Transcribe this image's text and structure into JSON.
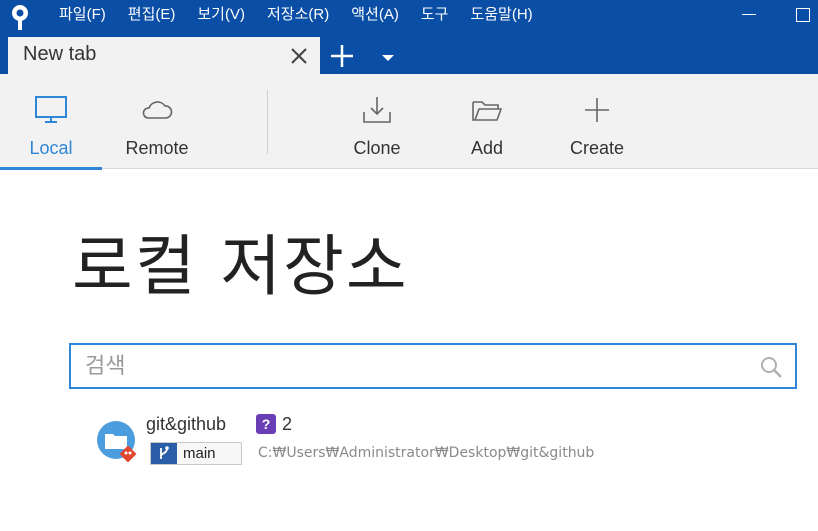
{
  "menu": {
    "items": [
      "파일(F)",
      "편집(E)",
      "보기(V)",
      "저장소(R)",
      "액션(A)",
      "도구",
      "도움말(H)"
    ]
  },
  "tabs": [
    {
      "title": "New tab",
      "active": true
    }
  ],
  "toolbar": {
    "local_label": "Local",
    "remote_label": "Remote",
    "clone_label": "Clone",
    "add_label": "Add",
    "create_label": "Create"
  },
  "main": {
    "title": "로컬 저장소",
    "search": {
      "placeholder": "검색",
      "value": ""
    },
    "repositories": [
      {
        "name": "git&github",
        "status_badge": "?",
        "status_count": "2",
        "branch": "main",
        "path": "C:₩Users₩Administrator₩Desktop₩git&github"
      }
    ]
  },
  "colors": {
    "titlebar": "#0a4ea6",
    "accent": "#2f86d6",
    "toolbar_bg": "#f2f2f2",
    "status_badge": "#6a3fb5",
    "branch_badge": "#2b5ea8",
    "git_red": "#e2462f"
  },
  "icons": {
    "app": "sourcetree-logo-icon",
    "local": "monitor-icon",
    "remote": "cloud-icon",
    "clone": "download-tray-icon",
    "add": "folder-open-icon",
    "create": "plus-icon",
    "search": "magnifier-icon",
    "repo": "folder-git-icon",
    "branch": "branch-icon"
  }
}
